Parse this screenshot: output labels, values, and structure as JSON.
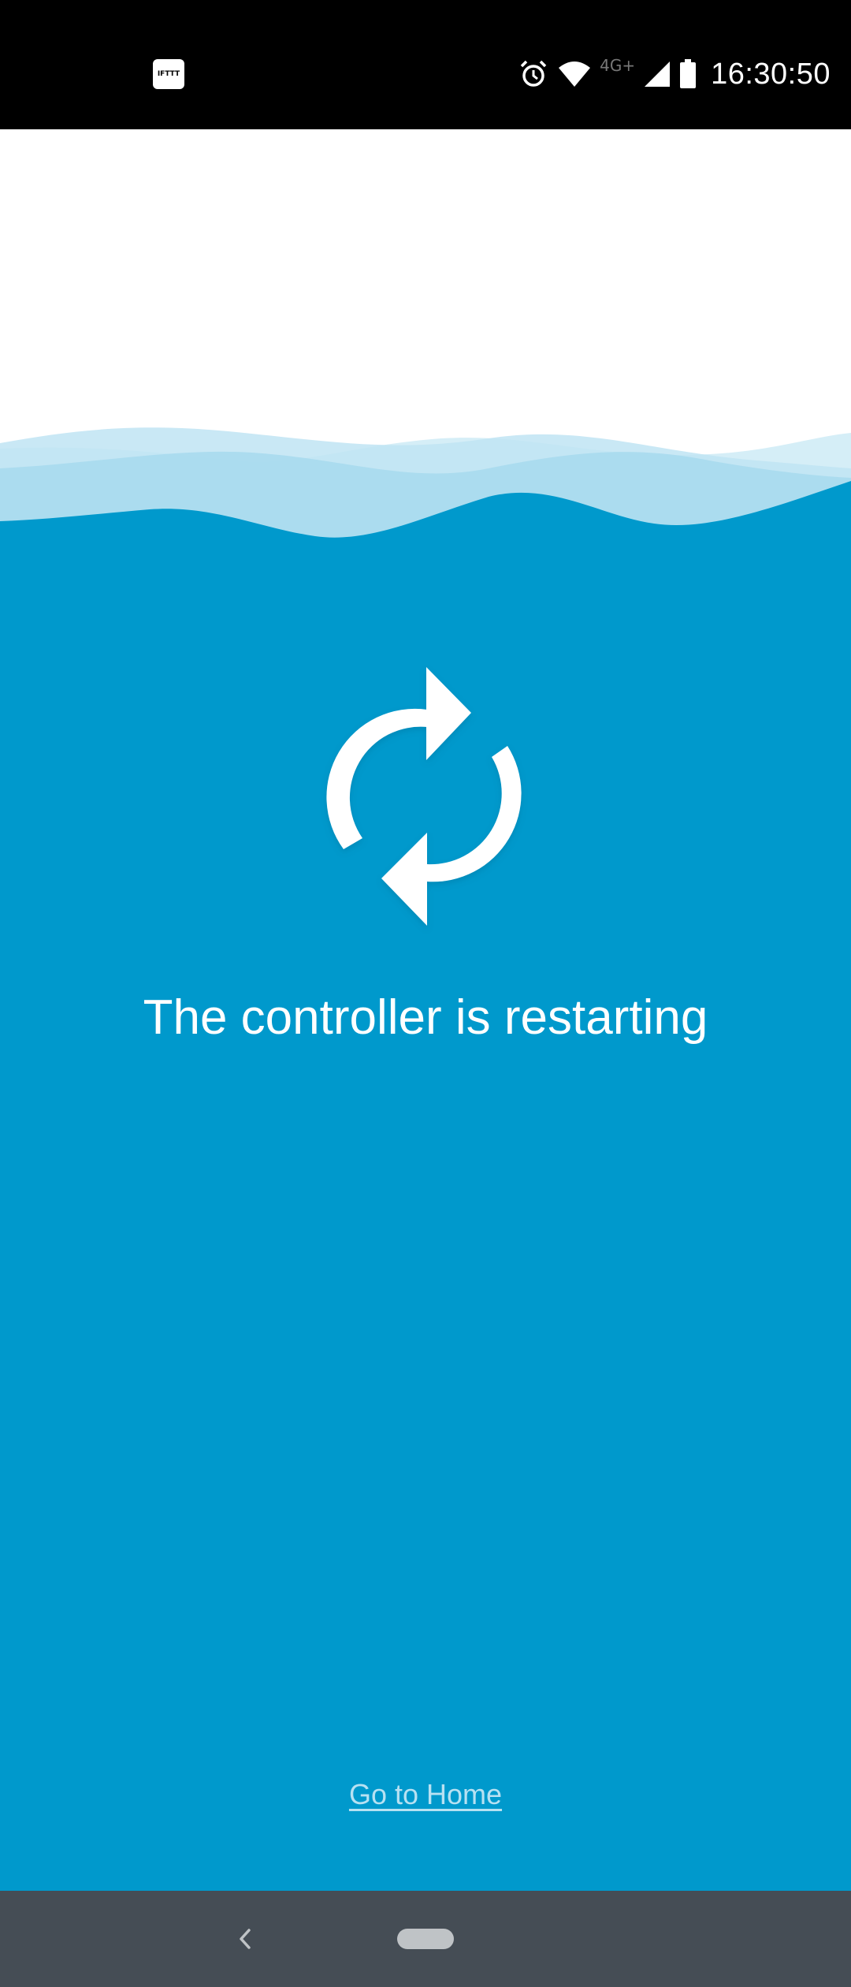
{
  "status_bar": {
    "app_icon_label": "IFTTT",
    "network_label": "4G+",
    "time": "16:30:50",
    "icons": [
      "alarm-icon",
      "wifi-icon",
      "cell-signal-icon",
      "battery-icon"
    ]
  },
  "main": {
    "headline": "The controller is restarting",
    "icon": "refresh-icon",
    "home_link": "Go to Home"
  },
  "nav_bar": {
    "icons": [
      "back-icon",
      "home-pill-icon"
    ]
  },
  "colors": {
    "status_bar_bg": "#000000",
    "background": "#0099CC",
    "wave_light": "#D5EEF7",
    "wave_mid": "#A9DAEE",
    "link": "#B7E1F2",
    "nav_bar_bg": "#454D55"
  }
}
